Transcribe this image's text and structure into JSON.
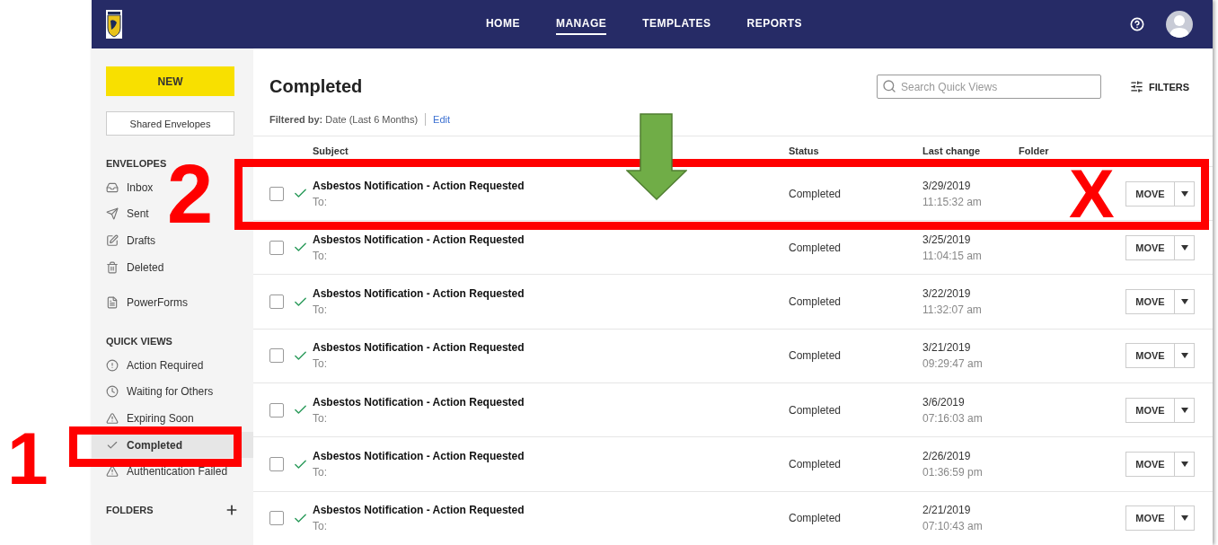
{
  "nav": {
    "items": [
      {
        "label": "HOME",
        "selected": false
      },
      {
        "label": "MANAGE",
        "selected": true
      },
      {
        "label": "TEMPLATES",
        "selected": false
      },
      {
        "label": "REPORTS",
        "selected": false
      }
    ]
  },
  "sidebar": {
    "new_button": "NEW",
    "shared_button": "Shared Envelopes",
    "sections": [
      {
        "title": "ENVELOPES",
        "items": [
          {
            "label": "Inbox",
            "selected": false
          },
          {
            "label": "Sent",
            "selected": false
          },
          {
            "label": "Drafts",
            "selected": false
          },
          {
            "label": "Deleted",
            "selected": false
          }
        ]
      },
      {
        "items": [
          {
            "label": "PowerForms",
            "selected": false
          }
        ]
      },
      {
        "title": "QUICK VIEWS",
        "items": [
          {
            "label": "Action Required",
            "selected": false
          },
          {
            "label": "Waiting for Others",
            "selected": false
          },
          {
            "label": "Expiring Soon",
            "selected": false
          },
          {
            "label": "Completed",
            "selected": true
          },
          {
            "label": "Authentication Failed",
            "selected": false
          }
        ]
      },
      {
        "title": "FOLDERS",
        "add": true
      }
    ]
  },
  "main": {
    "title": "Completed",
    "search": {
      "placeholder": "Search Quick Views"
    },
    "filters_button": "FILTERS",
    "filter": {
      "label": "Filtered by:",
      "value": "Date (Last 6 Months)",
      "edit": "Edit"
    }
  },
  "table": {
    "columns": [
      "Subject",
      "Status",
      "Last change",
      "Folder"
    ],
    "rows": [
      {
        "subject": "Asbestos Notification - Action Requested",
        "to": "To:",
        "status": "Completed",
        "date": "3/29/2019",
        "time": "11:15:32 am",
        "checked": false,
        "move": "MOVE"
      },
      {
        "subject": "Asbestos Notification - Action Requested",
        "to": "To:",
        "status": "Completed",
        "date": "3/25/2019",
        "time": "11:04:15 am",
        "checked": false,
        "move": "MOVE"
      },
      {
        "subject": "Asbestos Notification - Action Requested",
        "to": "To:",
        "status": "Completed",
        "date": "3/22/2019",
        "time": "11:32:07 am",
        "checked": false,
        "move": "MOVE"
      },
      {
        "subject": "Asbestos Notification - Action Requested",
        "to": "To:",
        "status": "Completed",
        "date": "3/21/2019",
        "time": "09:29:47 am",
        "checked": false,
        "move": "MOVE"
      },
      {
        "subject": "Asbestos Notification - Action Requested",
        "to": "To:",
        "status": "Completed",
        "date": "3/6/2019",
        "time": "07:16:03 am",
        "checked": false,
        "move": "MOVE"
      },
      {
        "subject": "Asbestos Notification - Action Requested",
        "to": "To:",
        "status": "Completed",
        "date": "2/26/2019",
        "time": "01:36:59 pm",
        "checked": false,
        "move": "MOVE"
      },
      {
        "subject": "Asbestos Notification - Action Requested",
        "to": "To:",
        "status": "Completed",
        "date": "2/21/2019",
        "time": "07:10:43 am",
        "checked": false,
        "move": "MOVE"
      }
    ]
  },
  "annotations": [
    {
      "kind": "label",
      "text": "1"
    },
    {
      "kind": "box"
    },
    {
      "kind": "label",
      "text": "2"
    },
    {
      "kind": "box"
    },
    {
      "kind": "arrow"
    },
    {
      "kind": "label",
      "text": "X"
    }
  ]
}
